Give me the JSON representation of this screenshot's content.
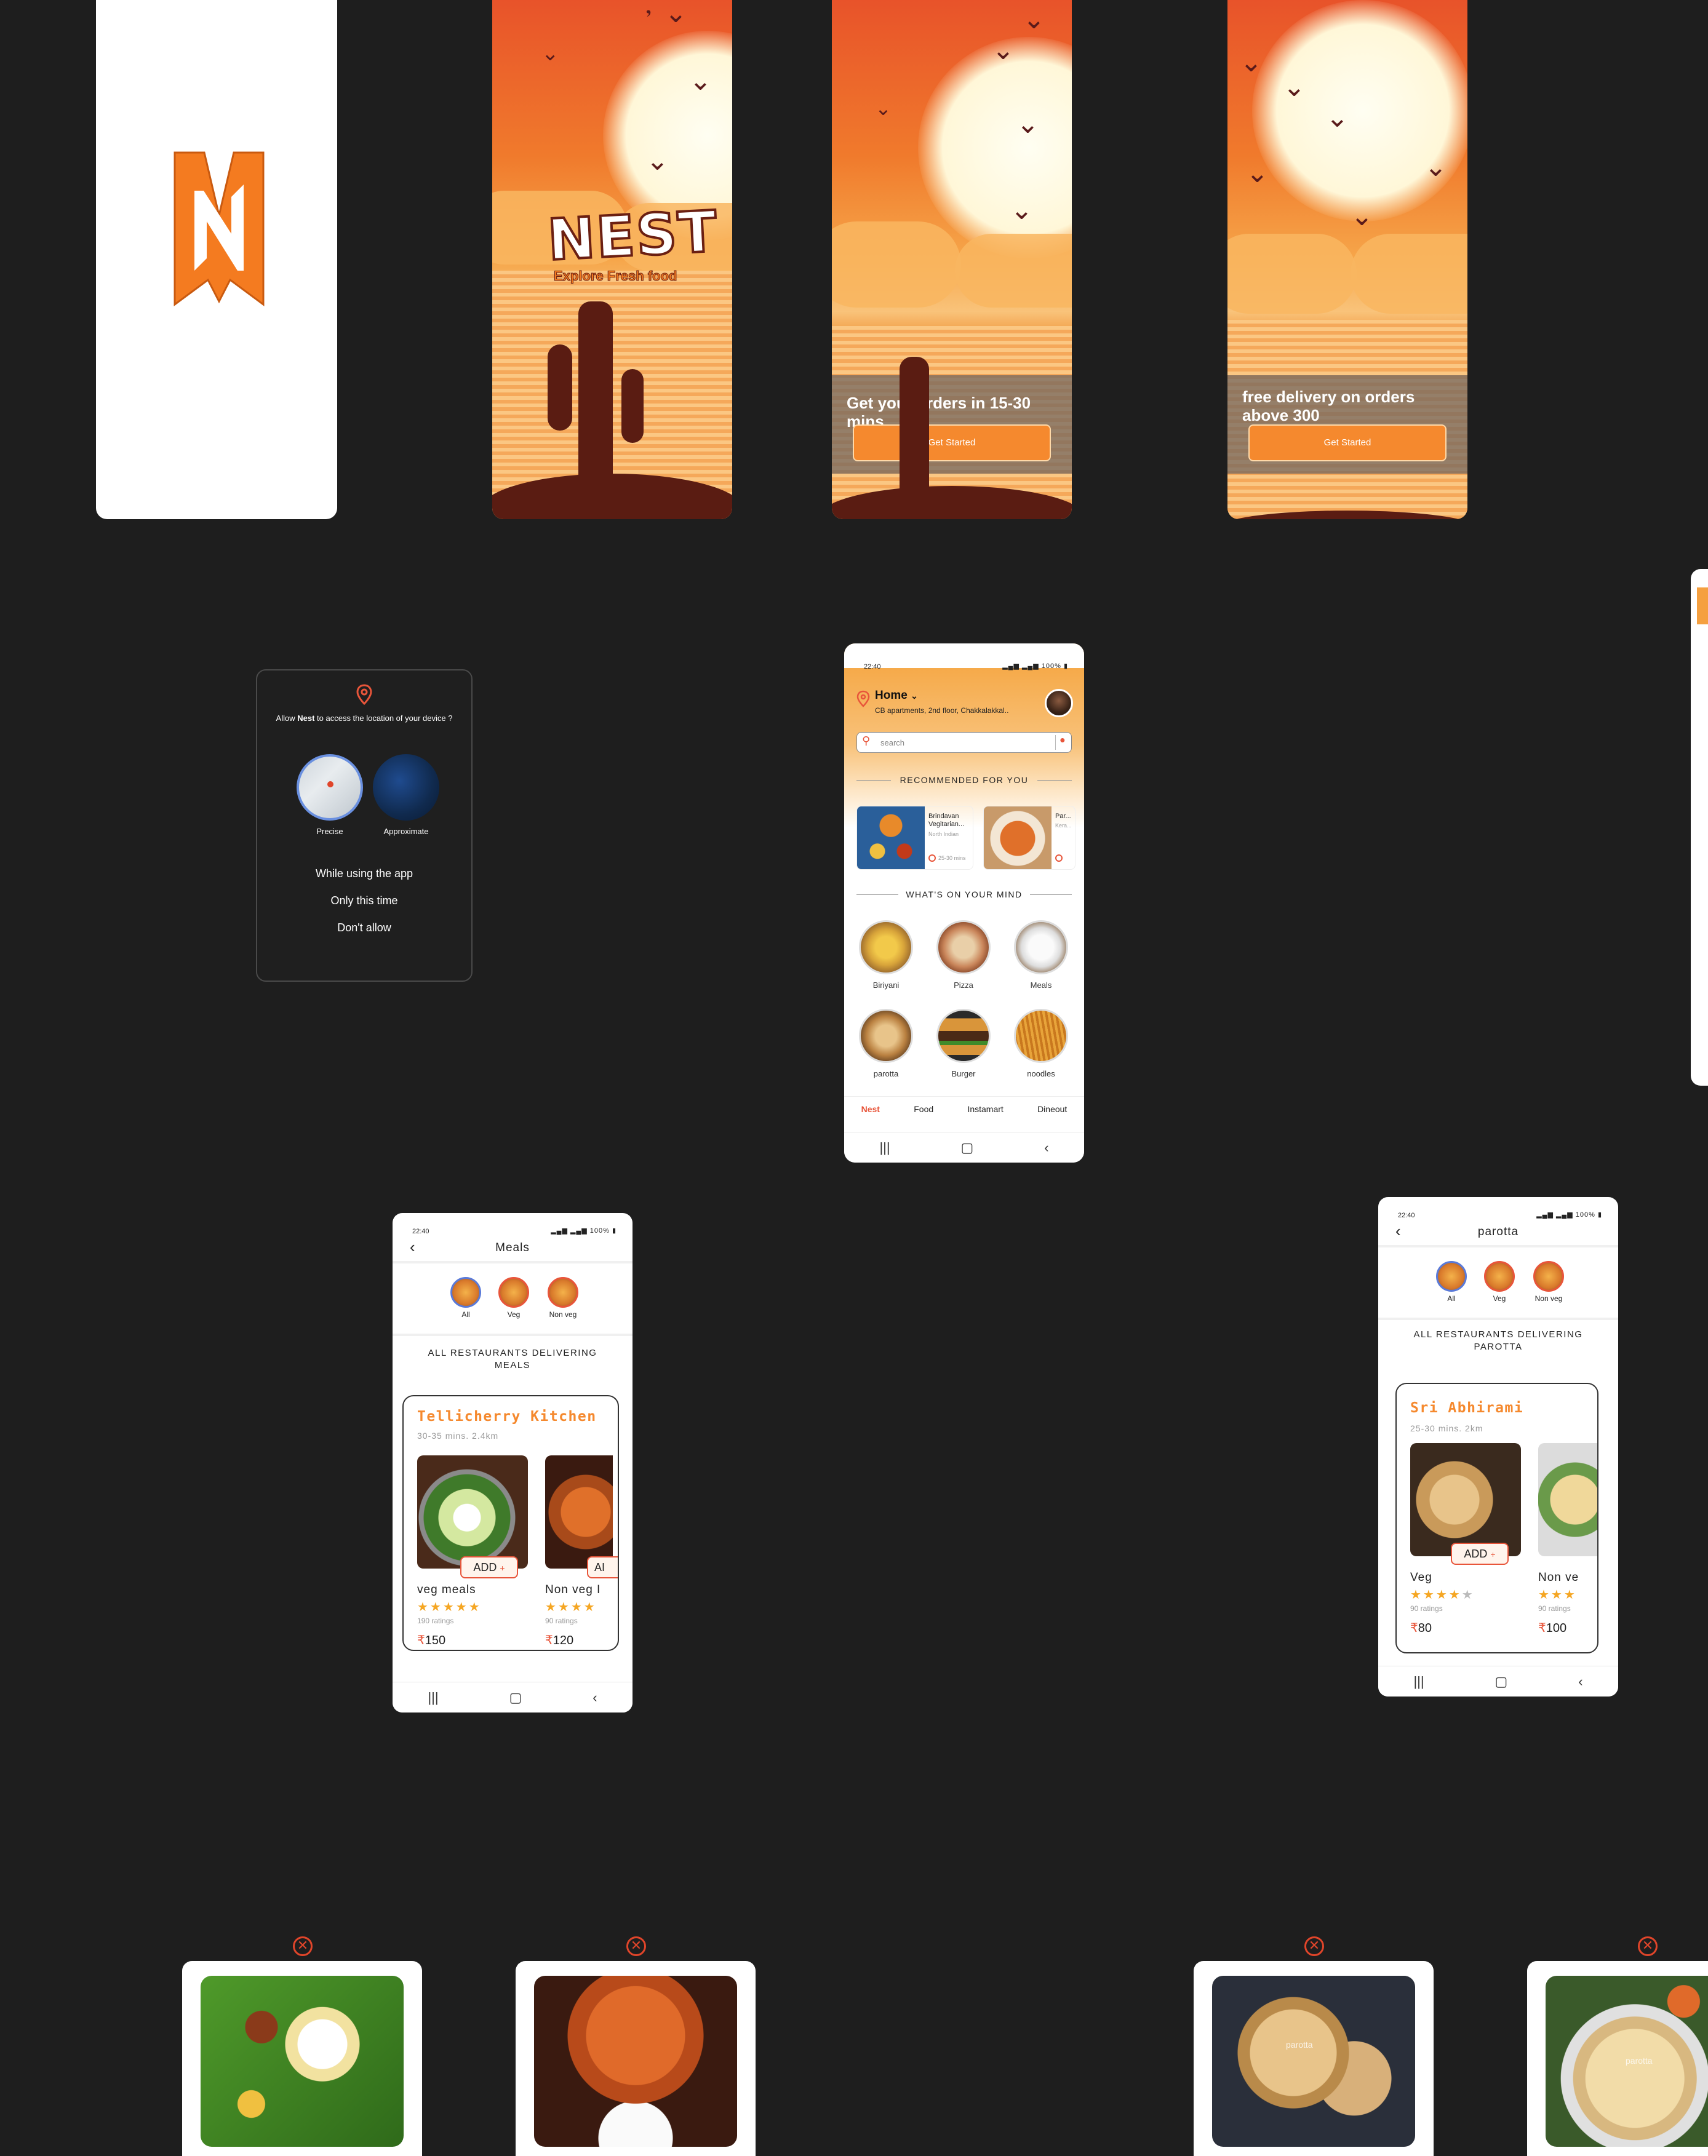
{
  "onboarding": {
    "nest_title": "NEST",
    "tagline": "Explore Fresh food",
    "slide2_text": "Get your orders in 15-30 mins",
    "slide3_text": "free delivery on orders above 300",
    "cta_label": "Get Started"
  },
  "permission": {
    "prompt_pre": "Allow ",
    "prompt_app": "Nest",
    "prompt_post": " to access the location of your device ?",
    "precise_label": "Precise",
    "approx_label": "Approximate",
    "options": [
      "While using the app",
      "Only this time",
      "Don't allow"
    ]
  },
  "home": {
    "time": "22:40",
    "battery": "100%",
    "location_title": "Home",
    "address": "CB apartments, 2nd floor, Chakkalakkal..",
    "search_placeholder": "search",
    "recommended_title": "RECOMMENDED FOR YOU",
    "rec1_name": "Brindavan Vegitarian...",
    "rec1_sub": "North Indian",
    "rec1_time": "25-30 mins",
    "rec2_name": "Par...",
    "rec2_sub": "Kera...",
    "mind_title": "WHAT'S ON YOUR MIND",
    "categories": [
      "Biriyani",
      "Pizza",
      "Meals",
      "parotta",
      "Burger",
      "noodles"
    ],
    "tabs": [
      "Nest",
      "Food",
      "Instamart",
      "Dineout"
    ]
  },
  "meals": {
    "time": "22:40",
    "battery": "100%",
    "title": "Meals",
    "filters": [
      "All",
      "Veg",
      "Non veg"
    ],
    "section_title": "ALL RESTAURANTS DELIVERING MEALS",
    "restaurant": "Tellicherry Kitchen",
    "meta": "30-35 mins. 2.4km",
    "add_label": "ADD",
    "add_plus": "+",
    "add_partial": "AI",
    "item1_name": "veg meals",
    "item1_ratings": "190 ratings",
    "item1_price": "150",
    "item2_name": "Non veg I",
    "item2_ratings": "90 ratings",
    "item2_price": "120",
    "rupee": "₹"
  },
  "parotta": {
    "time": "22:40",
    "battery": "100%",
    "title": "parotta",
    "filters": [
      "All",
      "Veg",
      "Non veg"
    ],
    "section_title": "ALL RESTAURANTS DELIVERING PAROTTA",
    "restaurant": "Sri Abhirami",
    "meta": "25-30 mins. 2km",
    "add_label": "ADD",
    "add_plus": "+",
    "item1_name": "Veg",
    "item1_ratings": "90 ratings",
    "item1_price": "80",
    "item2_name": "Non ve",
    "item2_ratings": "90 ratings",
    "item2_price": "100",
    "rupee": "₹"
  },
  "previews": {
    "parotta_label": "parotta"
  },
  "colors": {
    "accent": "#f5892e",
    "brand_red": "#e8553a",
    "background": "#1e1e1e"
  }
}
